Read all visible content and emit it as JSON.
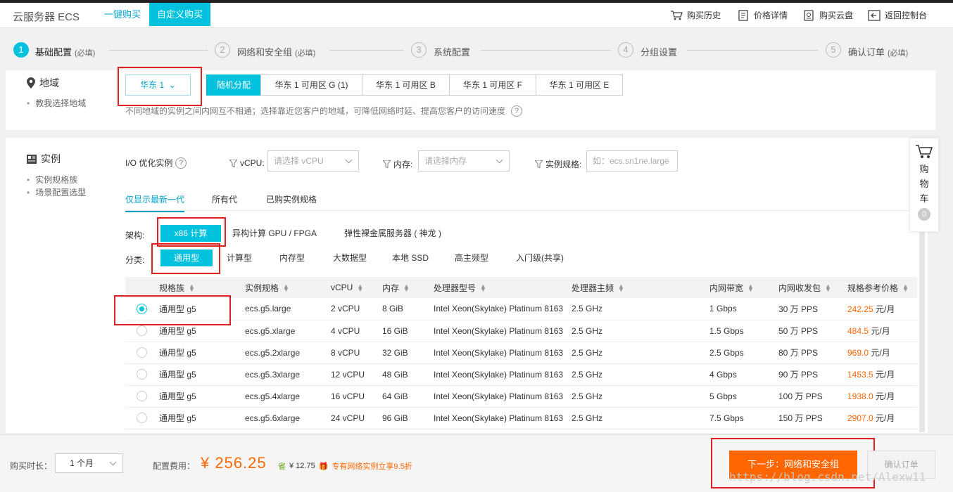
{
  "header": {
    "title": "云服务器 ECS",
    "tabs": [
      "一键购买",
      "自定义购买"
    ],
    "links": [
      "购买历史",
      "价格详情",
      "购买云盘",
      "返回控制台"
    ]
  },
  "steps": [
    {
      "num": "1",
      "label": "基础配置",
      "note": "(必填)"
    },
    {
      "num": "2",
      "label": "网络和安全组",
      "note": "(必填)"
    },
    {
      "num": "3",
      "label": "系统配置",
      "note": ""
    },
    {
      "num": "4",
      "label": "分组设置",
      "note": ""
    },
    {
      "num": "5",
      "label": "确认订单",
      "note": "(必填)"
    }
  ],
  "region": {
    "title": "地域",
    "help_link": "教我选择地域",
    "selected_region": "华东 1",
    "zones": [
      "随机分配",
      "华东 1 可用区 G (1)",
      "华东 1 可用区 B",
      "华东 1 可用区 F",
      "华东 1 可用区 E"
    ],
    "hint": "不同地域的实例之间内网互不相通；选择靠近您客户的地域，可降低网络时延、提高您客户的访问速度",
    "help_icon": "?"
  },
  "instance": {
    "title": "实例",
    "links": [
      "实例规格族",
      "场景配置选型"
    ],
    "filters": {
      "io_label": "I/O 优化实例",
      "vcpu_label": "vCPU:",
      "vcpu_placeholder": "请选择 vCPU",
      "memory_label": "内存:",
      "memory_placeholder": "请选择内存",
      "spec_label": "实例规格:",
      "spec_placeholder": "如：ecs.sn1ne.large"
    },
    "gen_tabs": [
      "仅显示最新一代",
      "所有代",
      "已购实例规格"
    ],
    "arch_label": "架构:",
    "arch_options": [
      "x86 计算",
      "异构计算 GPU / FPGA",
      "弹性裸金属服务器 ( 神龙 )"
    ],
    "category_label": "分类:",
    "categories": [
      "通用型",
      "计算型",
      "内存型",
      "大数据型",
      "本地 SSD",
      "高主频型",
      "入门级(共享)"
    ],
    "columns": [
      "规格族",
      "实例规格",
      "vCPU",
      "内存",
      "处理器型号",
      "处理器主频",
      "内网带宽",
      "内网收发包",
      "规格参考价格"
    ],
    "rows": [
      {
        "family": "通用型 g5",
        "spec": "ecs.g5.large",
        "vcpu": "2 vCPU",
        "mem": "8 GiB",
        "cpu": "Intel Xeon(Skylake) Platinum 8163",
        "freq": "2.5 GHz",
        "bw": "1 Gbps",
        "pps": "30 万 PPS",
        "price": "242.25",
        "unit": " 元/月"
      },
      {
        "family": "通用型 g5",
        "spec": "ecs.g5.xlarge",
        "vcpu": "4 vCPU",
        "mem": "16 GiB",
        "cpu": "Intel Xeon(Skylake) Platinum 8163",
        "freq": "2.5 GHz",
        "bw": "1.5 Gbps",
        "pps": "50 万 PPS",
        "price": "484.5",
        "unit": " 元/月"
      },
      {
        "family": "通用型 g5",
        "spec": "ecs.g5.2xlarge",
        "vcpu": "8 vCPU",
        "mem": "32 GiB",
        "cpu": "Intel Xeon(Skylake) Platinum 8163",
        "freq": "2.5 GHz",
        "bw": "2.5 Gbps",
        "pps": "80 万 PPS",
        "price": "969.0",
        "unit": " 元/月"
      },
      {
        "family": "通用型 g5",
        "spec": "ecs.g5.3xlarge",
        "vcpu": "12 vCPU",
        "mem": "48 GiB",
        "cpu": "Intel Xeon(Skylake) Platinum 8163",
        "freq": "2.5 GHz",
        "bw": "4 Gbps",
        "pps": "90 万 PPS",
        "price": "1453.5",
        "unit": " 元/月"
      },
      {
        "family": "通用型 g5",
        "spec": "ecs.g5.4xlarge",
        "vcpu": "16 vCPU",
        "mem": "64 GiB",
        "cpu": "Intel Xeon(Skylake) Platinum 8163",
        "freq": "2.5 GHz",
        "bw": "5 Gbps",
        "pps": "100 万 PPS",
        "price": "1938.0",
        "unit": " 元/月"
      },
      {
        "family": "通用型 g5",
        "spec": "ecs.g5.6xlarge",
        "vcpu": "24 vCPU",
        "mem": "96 GiB",
        "cpu": "Intel Xeon(Skylake) Platinum 8163",
        "freq": "2.5 GHz",
        "bw": "7.5 Gbps",
        "pps": "150 万 PPS",
        "price": "2907.0",
        "unit": " 元/月"
      }
    ]
  },
  "cart": {
    "label": "购物车",
    "count": "0"
  },
  "footer": {
    "duration_label": "购买时长：",
    "duration_value": "1 个月",
    "fee_label": "配置费用：",
    "fee_value": "¥ 256.25",
    "saving_prefix": "省",
    "saving_value": "¥ 12.75",
    "promo": "专有网络实例立享9.5折",
    "next_button": "下一步：网络和安全组",
    "confirm_button": "确认订单",
    "watermark": "https://blog.csdn.net/Alexw11"
  },
  "colors": {
    "accent": "#00c1de",
    "link": "#00a2ca",
    "price": "#ff6600",
    "highlight": "#e02020"
  }
}
